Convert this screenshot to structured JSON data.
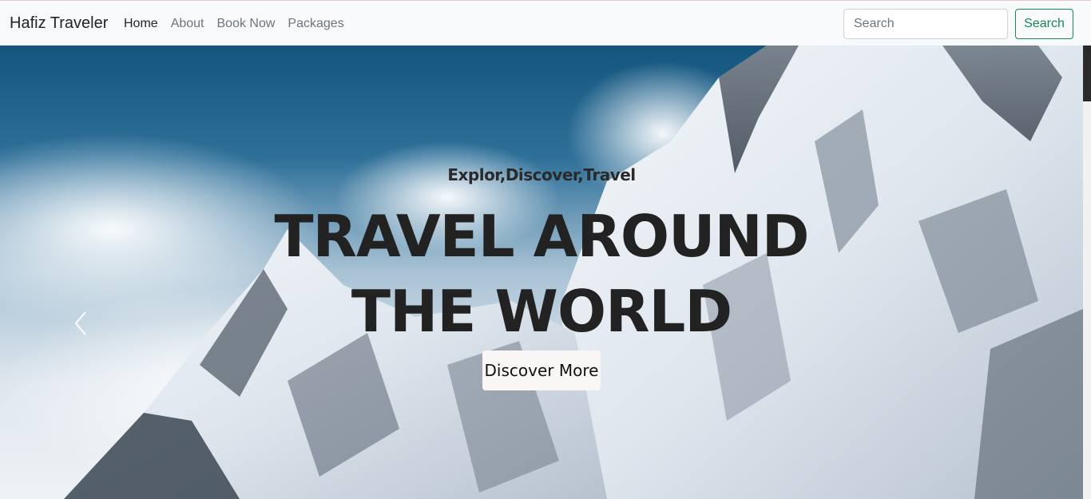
{
  "navbar": {
    "brand": "Hafiz Traveler",
    "links": [
      {
        "label": "Home",
        "active": true
      },
      {
        "label": "About",
        "active": false
      },
      {
        "label": "Book Now",
        "active": false
      },
      {
        "label": "Packages",
        "active": false
      }
    ],
    "search": {
      "placeholder": "Search",
      "button_label": "Search"
    }
  },
  "hero": {
    "subtitle": "Explor,Discover,Travel",
    "title_line1": "TRAVEL AROUND",
    "title_line2": "THE WORLD",
    "cta_label": "Discover More",
    "prev_icon": "chevron-left-icon",
    "background": "snowy-mountain-photo"
  },
  "colors": {
    "navbar_bg": "#f8f9fa",
    "search_button": "#198754",
    "title_text": "#222222",
    "sky": "#1f5f85"
  }
}
